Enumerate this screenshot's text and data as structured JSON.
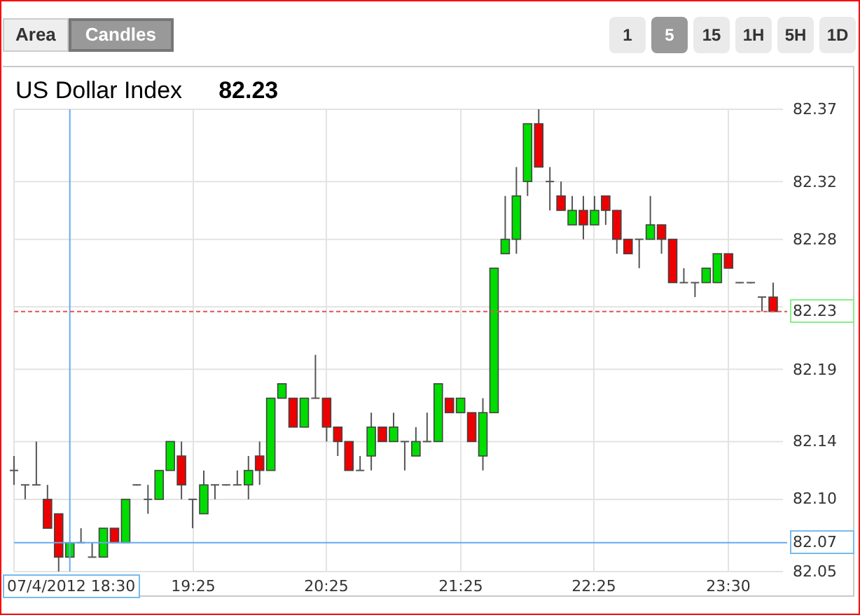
{
  "chart_types": [
    {
      "label": "Area",
      "selected": false
    },
    {
      "label": "Candles",
      "selected": true
    }
  ],
  "intervals": [
    {
      "label": "1",
      "selected": false
    },
    {
      "label": "5",
      "selected": true
    },
    {
      "label": "15",
      "selected": false
    },
    {
      "label": "1H",
      "selected": false
    },
    {
      "label": "5H",
      "selected": false
    },
    {
      "label": "1D",
      "selected": false
    }
  ],
  "chart": {
    "title": "US Dollar Index",
    "price": "82.23",
    "x_axis": [
      {
        "label": "07/4/2012 18:30",
        "kind": "cursor"
      },
      {
        "label": "19:25",
        "kind": "tick"
      },
      {
        "label": "20:25",
        "kind": "tick"
      },
      {
        "label": "21:25",
        "kind": "tick"
      },
      {
        "label": "22:25",
        "kind": "tick"
      },
      {
        "label": "23:30",
        "kind": "tick"
      }
    ],
    "chart_data": {
      "type": "candlestick",
      "ylim": [
        82.05,
        82.37
      ],
      "grid": true,
      "ref_lines": [
        {
          "axis": "y",
          "value": 82.23,
          "label": "82.23",
          "color": "#dd5555"
        },
        {
          "axis": "y",
          "value": 82.07,
          "label": "82.07",
          "color": "#66aaee"
        }
      ],
      "yticks": [
        {
          "value": 82.37,
          "label": "82.37"
        },
        {
          "value": 82.32,
          "label": "82.32"
        },
        {
          "value": 82.28,
          "label": "82.28"
        },
        {
          "value": 82.19,
          "label": "82.19"
        },
        {
          "value": 82.14,
          "label": "82.14"
        },
        {
          "value": 82.1,
          "label": "82.10"
        },
        {
          "value": 82.05,
          "label": "82.05"
        }
      ],
      "categories": [
        null,
        null,
        null,
        null,
        null,
        null,
        null,
        null,
        null,
        null,
        null,
        null,
        null,
        null,
        null,
        null,
        null,
        null,
        null,
        null,
        null,
        null,
        null,
        null,
        null,
        null,
        null,
        null,
        null,
        null,
        null,
        null,
        null,
        null,
        null,
        null,
        null,
        null,
        null,
        null,
        null,
        null,
        null,
        null,
        null,
        null,
        null,
        null,
        null,
        null,
        null,
        null,
        null,
        null,
        null,
        null,
        null,
        null,
        null,
        null,
        null,
        null,
        null,
        null,
        null,
        null,
        null,
        null,
        null
      ],
      "ohlc": [
        [
          82.12,
          82.13,
          82.11,
          82.12
        ],
        [
          82.11,
          82.11,
          82.1,
          82.11
        ],
        [
          82.11,
          82.14,
          82.11,
          82.11
        ],
        [
          82.1,
          82.11,
          82.08,
          82.08
        ],
        [
          82.09,
          82.09,
          82.05,
          82.06
        ],
        [
          82.06,
          82.07,
          82.06,
          82.07
        ],
        [
          82.07,
          82.08,
          82.07,
          82.07
        ],
        [
          82.06,
          82.07,
          82.06,
          82.06
        ],
        [
          82.06,
          82.08,
          82.06,
          82.08
        ],
        [
          82.08,
          82.08,
          82.07,
          82.07
        ],
        [
          82.07,
          82.1,
          82.07,
          82.1
        ],
        [
          82.11,
          82.11,
          82.11,
          82.11
        ],
        [
          82.1,
          82.11,
          82.09,
          82.1
        ],
        [
          82.1,
          82.12,
          82.1,
          82.12
        ],
        [
          82.12,
          82.14,
          82.12,
          82.14
        ],
        [
          82.13,
          82.14,
          82.1,
          82.11
        ],
        [
          82.1,
          82.1,
          82.08,
          82.1
        ],
        [
          82.09,
          82.12,
          82.09,
          82.11
        ],
        [
          82.11,
          82.11,
          82.1,
          82.11
        ],
        [
          82.11,
          82.11,
          82.11,
          82.11
        ],
        [
          82.11,
          82.12,
          82.11,
          82.11
        ],
        [
          82.11,
          82.13,
          82.1,
          82.12
        ],
        [
          82.13,
          82.14,
          82.11,
          82.12
        ],
        [
          82.12,
          82.17,
          82.12,
          82.17
        ],
        [
          82.17,
          82.18,
          82.17,
          82.18
        ],
        [
          82.17,
          82.17,
          82.15,
          82.15
        ],
        [
          82.15,
          82.17,
          82.15,
          82.17
        ],
        [
          82.17,
          82.2,
          82.17,
          82.17
        ],
        [
          82.17,
          82.17,
          82.14,
          82.15
        ],
        [
          82.15,
          82.15,
          82.13,
          82.14
        ],
        [
          82.14,
          82.14,
          82.12,
          82.12
        ],
        [
          82.12,
          82.13,
          82.12,
          82.12
        ],
        [
          82.13,
          82.16,
          82.12,
          82.15
        ],
        [
          82.15,
          82.15,
          82.14,
          82.14
        ],
        [
          82.14,
          82.16,
          82.14,
          82.15
        ],
        [
          82.14,
          82.14,
          82.12,
          82.14
        ],
        [
          82.13,
          82.15,
          82.13,
          82.14
        ],
        [
          82.14,
          82.16,
          82.14,
          82.14
        ],
        [
          82.14,
          82.18,
          82.14,
          82.18
        ],
        [
          82.17,
          82.17,
          82.16,
          82.16
        ],
        [
          82.16,
          82.17,
          82.16,
          82.17
        ],
        [
          82.16,
          82.16,
          82.14,
          82.14
        ],
        [
          82.13,
          82.17,
          82.12,
          82.16
        ],
        [
          82.16,
          82.26,
          82.16,
          82.26
        ],
        [
          82.27,
          82.31,
          82.27,
          82.28
        ],
        [
          82.28,
          82.33,
          82.27,
          82.31
        ],
        [
          82.32,
          82.36,
          82.31,
          82.36
        ],
        [
          82.36,
          82.37,
          82.33,
          82.33
        ],
        [
          82.32,
          82.33,
          82.3,
          82.32
        ],
        [
          82.31,
          82.32,
          82.3,
          82.3
        ],
        [
          82.29,
          82.31,
          82.29,
          82.3
        ],
        [
          82.3,
          82.31,
          82.28,
          82.29
        ],
        [
          82.29,
          82.31,
          82.29,
          82.3
        ],
        [
          82.31,
          82.31,
          82.29,
          82.3
        ],
        [
          82.3,
          82.3,
          82.27,
          82.28
        ],
        [
          82.28,
          82.28,
          82.27,
          82.27
        ],
        [
          82.28,
          82.28,
          82.26,
          82.28
        ],
        [
          82.28,
          82.31,
          82.28,
          82.29
        ],
        [
          82.29,
          82.29,
          82.27,
          82.28
        ],
        [
          82.28,
          82.28,
          82.25,
          82.25
        ],
        [
          82.25,
          82.26,
          82.25,
          82.25
        ],
        [
          82.25,
          82.25,
          82.24,
          82.25
        ],
        [
          82.25,
          82.26,
          82.25,
          82.26
        ],
        [
          82.25,
          82.27,
          82.25,
          82.27
        ],
        [
          82.27,
          82.27,
          82.26,
          82.26
        ],
        [
          82.25,
          82.25,
          82.25,
          82.25
        ],
        [
          82.25,
          82.25,
          82.25,
          82.25
        ],
        [
          82.24,
          82.24,
          82.23,
          82.24
        ],
        [
          82.24,
          82.25,
          82.23,
          82.23
        ]
      ]
    }
  }
}
